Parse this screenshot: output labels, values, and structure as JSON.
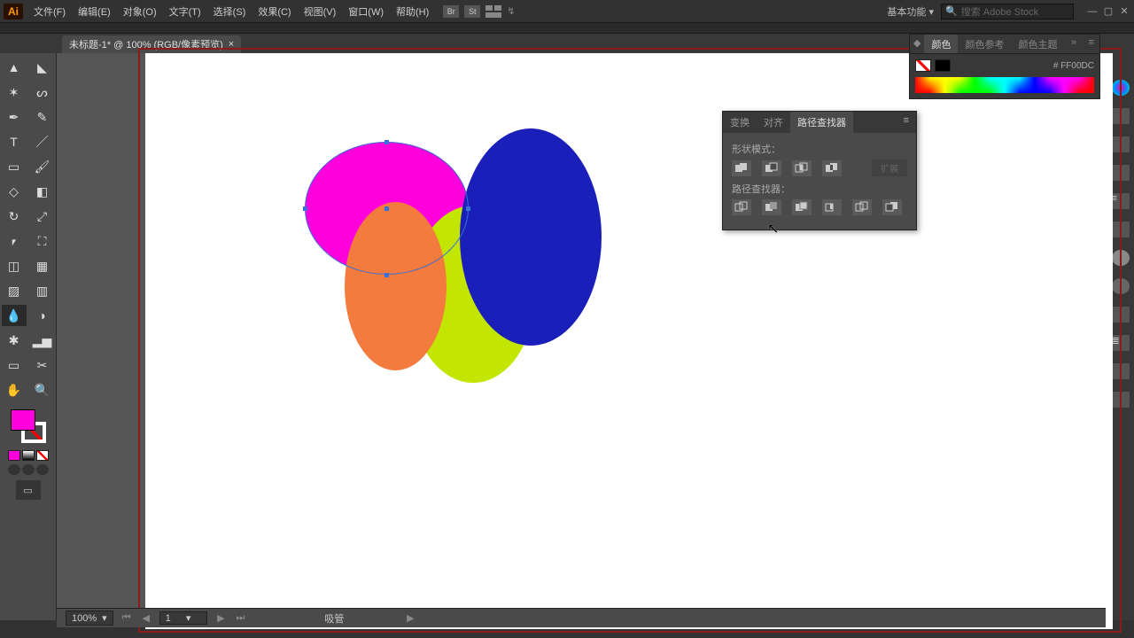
{
  "app": {
    "icon_text": "Ai"
  },
  "menu": {
    "file": "文件(F)",
    "edit": "编辑(E)",
    "object": "对象(O)",
    "type": "文字(T)",
    "select": "选择(S)",
    "effect": "效果(C)",
    "view": "视图(V)",
    "window": "窗口(W)",
    "help": "帮助(H)"
  },
  "top_icons": {
    "br": "Br",
    "st": "St"
  },
  "top_right": {
    "workspace": "基本功能",
    "search_placeholder": "搜索 Adobe Stock"
  },
  "doc_tab": {
    "title": "未标题-1* @ 100% (RGB/像素预览)",
    "close": "×"
  },
  "color_panel": {
    "tab_color": "颜色",
    "tab_guide": "颜色参考",
    "tab_theme": "颜色主题",
    "hex_prefix": "#",
    "hex_value": "FF00DC",
    "expand": "»"
  },
  "pathfinder": {
    "tab_transform": "变换",
    "tab_align": "对齐",
    "tab_pathfinder": "路径查找器",
    "shape_modes_label": "形状模式：",
    "expand_btn": "扩展",
    "pathfinders_label": "路径查找器："
  },
  "status": {
    "zoom": "100%",
    "page": "1",
    "tool": "吸管"
  },
  "fill_color": "#ff00dc"
}
